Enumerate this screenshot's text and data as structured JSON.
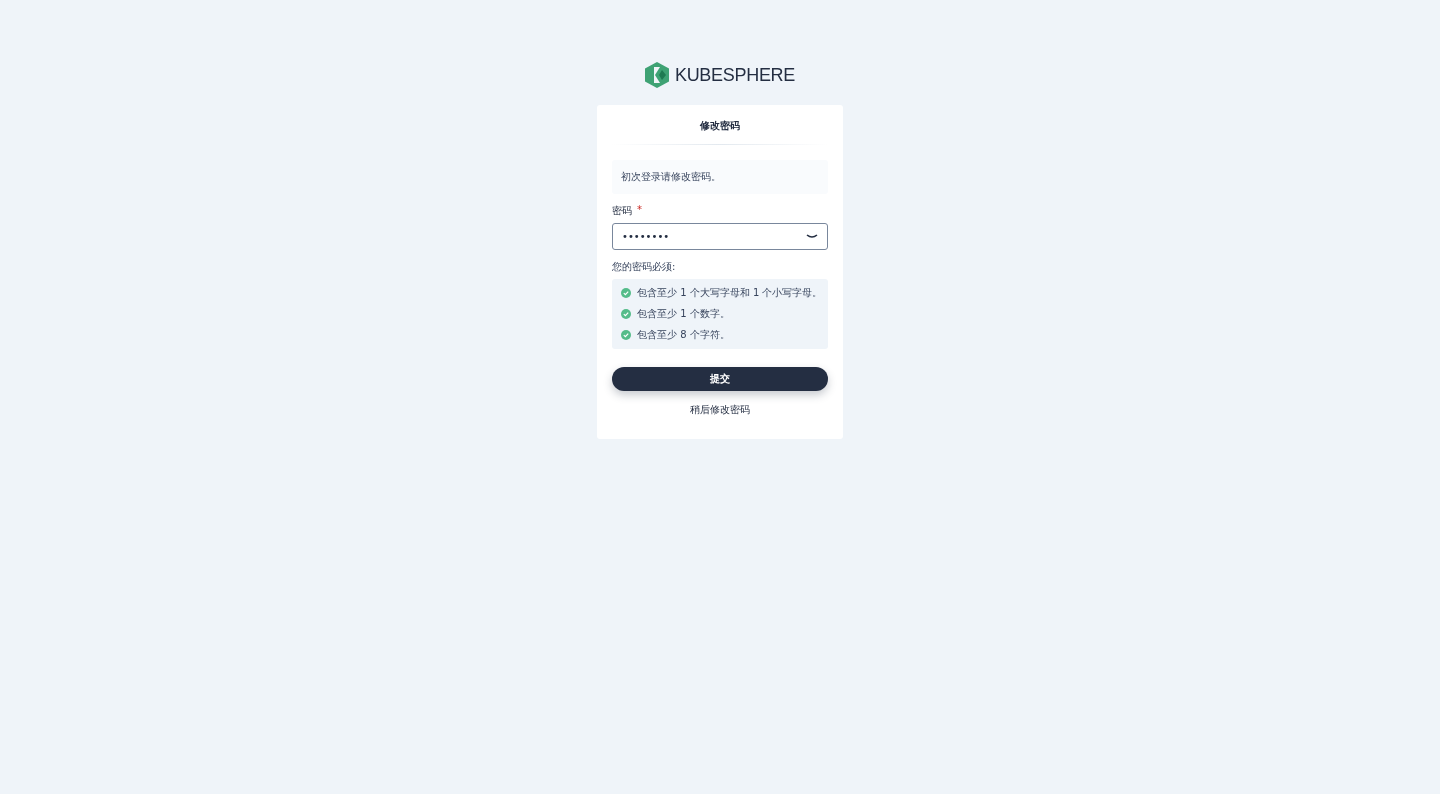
{
  "logo": {
    "text": "KUBESPHERE"
  },
  "card": {
    "title": "修改密码",
    "notice": "初次登录请修改密码。",
    "password": {
      "label": "密码",
      "required": true,
      "required_mark": "*",
      "value": "••••••••"
    },
    "rules_title": "您的密码必须:",
    "rules": [
      {
        "text": "包含至少 1 个大写字母和 1 个小写字母。",
        "met": true
      },
      {
        "text": "包含至少 1 个数字。",
        "met": true
      },
      {
        "text": "包含至少 8 个字符。",
        "met": true
      }
    ],
    "submit": "提交",
    "later": "稍后修改密码"
  }
}
